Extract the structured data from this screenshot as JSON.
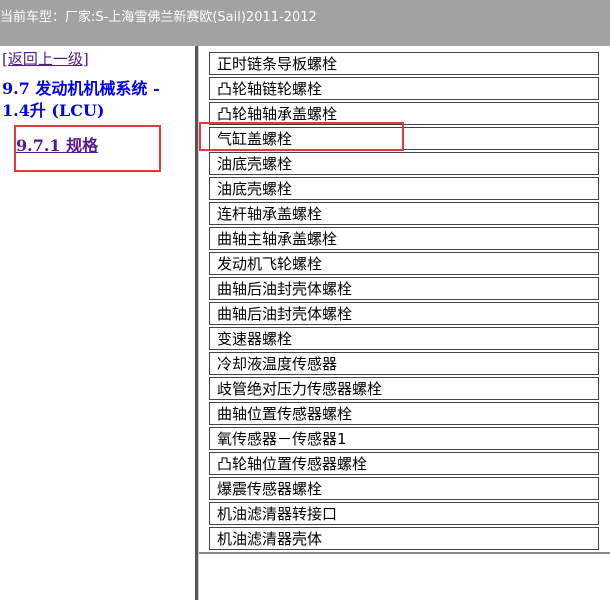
{
  "header": {
    "label": "当前车型：",
    "vehicle": "厂家:S-上海雪佛兰新赛欧(Sail)2011-2012"
  },
  "sidebar": {
    "back_link": "[返回上一级]",
    "section_title": "9.7 发动机机械系统 - 1.4升 (LCU)",
    "spec_link": "9.7.1 规格"
  },
  "list": {
    "items": [
      "正时链条导板螺栓",
      "凸轮轴链轮螺栓",
      "凸轮轴轴承盖螺栓",
      "气缸盖螺栓",
      "油底壳螺栓",
      "油底壳螺栓",
      "连杆轴承盖螺栓",
      "曲轴主轴承盖螺栓",
      "发动机飞轮螺栓",
      "曲轴后油封壳体螺栓",
      "曲轴后油封壳体螺栓",
      "变速器螺栓",
      "冷却液温度传感器",
      "歧管绝对压力传感器螺栓",
      "曲轴位置传感器螺栓",
      "氧传感器－传感器1",
      "凸轮轴位置传感器螺栓",
      "爆震传感器螺栓",
      "机油滤清器转接口",
      "机油滤清器壳体"
    ]
  },
  "colors": {
    "header_bg": "#a2a2a2",
    "link_visited": "#551a8b",
    "link_blue": "#0000ee",
    "highlight": "#e33b3b"
  }
}
